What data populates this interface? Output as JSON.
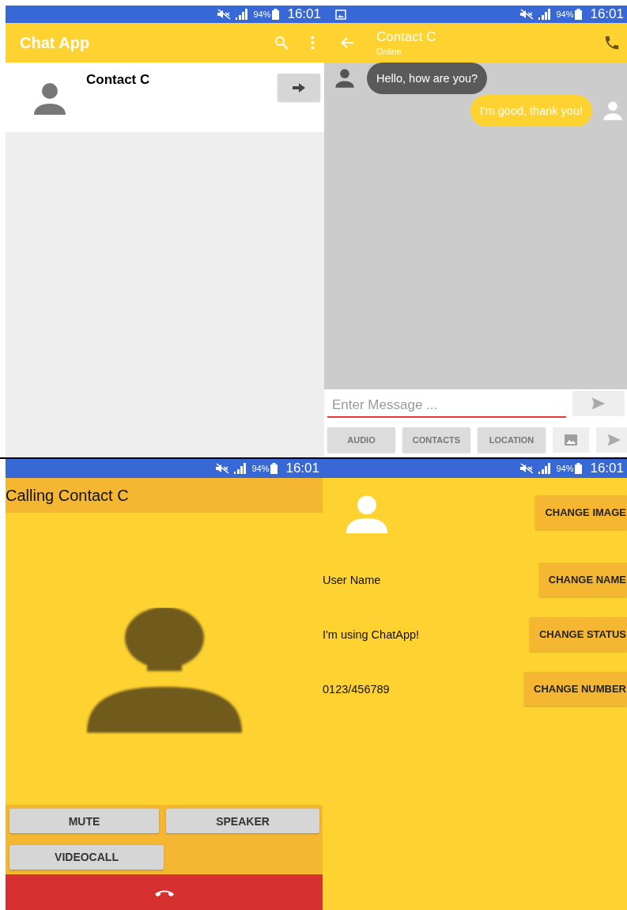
{
  "screens": [
    {
      "kind": "chat_list",
      "status_bar": {
        "gallery_notification": false,
        "battery": "94%",
        "time": "16:01"
      },
      "title": "Chat App",
      "contacts": [
        {
          "name": "Contact C"
        }
      ]
    },
    {
      "kind": "chat",
      "status_bar": {
        "gallery_notification": true,
        "battery": "94%",
        "time": "16:01"
      },
      "contact": "Contact C",
      "presence": "Online",
      "messages": [
        {
          "kind": "incoming",
          "text": "Hello, how are you?"
        },
        {
          "kind": "outgoing",
          "text": "I'm good, thank you!"
        }
      ],
      "input": {
        "placeholder": "Enter Message ..."
      },
      "attachment_buttons": [
        "AUDIO",
        "CONTACTS",
        "LOCATION"
      ]
    },
    {
      "kind": "call",
      "status_bar": {
        "gallery_notification": false,
        "battery": "94%",
        "time": "16:01"
      },
      "title": "Calling Contact C",
      "buttons": [
        "MUTE",
        "SPEAKER",
        "VIDEOCALL"
      ]
    },
    {
      "kind": "profile",
      "status_bar": {
        "gallery_notification": false,
        "battery": "94%",
        "time": "16:01"
      },
      "rows": [
        {
          "kind": "image",
          "button": "CHANGE IMAGE"
        },
        {
          "kind": "text",
          "value": "User Name",
          "button": "CHANGE NAME"
        },
        {
          "kind": "text",
          "value": "I'm using ChatApp!",
          "button": "CHANGE STATUS"
        },
        {
          "kind": "text",
          "value": "0123/456789",
          "button": "CHANGE NUMBER"
        }
      ]
    }
  ]
}
